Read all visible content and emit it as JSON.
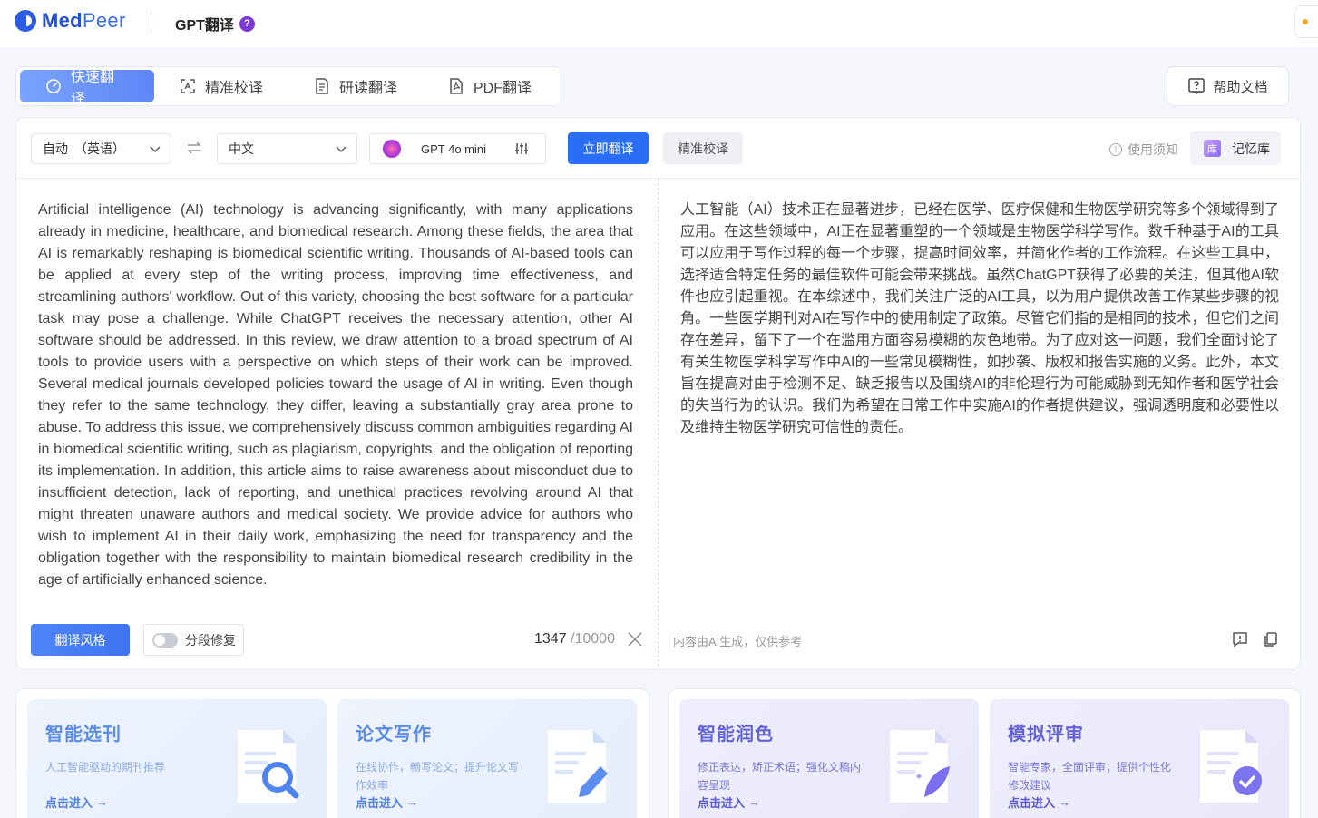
{
  "header": {
    "logo_text_bold": "Med",
    "logo_text_light": "Peer",
    "title": "GPT翻译",
    "help_mark": "?"
  },
  "modes": {
    "tabs": [
      {
        "label": "快速翻译",
        "icon": "gauge-icon",
        "active": true
      },
      {
        "label": "精准校译",
        "icon": "scan-icon",
        "active": false
      },
      {
        "label": "研读翻译",
        "icon": "document-icon",
        "active": false
      },
      {
        "label": "PDF翻译",
        "icon": "pdf-icon",
        "active": false
      }
    ],
    "help_doc": "帮助文档"
  },
  "toolbar": {
    "source_lang": "自动　（英语）",
    "target_lang": "中文",
    "model": "GPT 4o mini",
    "translate_btn": "立即翻译",
    "proof_btn": "精准校译",
    "notice": "使用须知",
    "memory_icon_text": "库",
    "memory": "记忆库"
  },
  "source_text": "Artificial intelligence (AI) technology is advancing significantly, with many applications already in medicine, healthcare, and biomedical research. Among these fields, the area that AI is remarkably reshaping is biomedical scientific writing. Thousands of AI-based tools can be applied at every step of the writing process, improving time effectiveness, and streamlining authors' workflow. Out of this variety, choosing the best software for a particular task may pose a challenge. While ChatGPT receives the necessary attention, other AI software should be addressed. In this review, we draw attention to a broad spectrum of AI tools to provide users with a perspective on which steps of their work can be improved. Several medical journals developed policies toward the usage of AI in writing. Even though they refer to the same technology, they differ, leaving a substantially gray area prone to abuse. To address this issue, we comprehensively discuss common ambiguities regarding AI in biomedical scientific writing, such as plagiarism, copyrights, and the obligation of reporting its implementation. In addition, this article aims to raise awareness about misconduct due to insufficient detection, lack of reporting, and unethical practices revolving around AI that might threaten unaware authors and medical society. We provide advice for authors who wish to implement AI in their daily work, emphasizing the need for transparency and the obligation together with the responsibility to maintain biomedical research credibility in the age of artificially enhanced science.",
  "target_text": "人工智能（AI）技术正在显著进步，已经在医学、医疗保健和生物医学研究等多个领域得到了应用。在这些领域中，AI正在显著重塑的一个领域是生物医学科学写作。数千种基于AI的工具可以应用于写作过程的每一个步骤，提高时间效率，并简化作者的工作流程。在这些工具中，选择适合特定任务的最佳软件可能会带来挑战。虽然ChatGPT获得了必要的关注，但其他AI软件也应引起重视。在本综述中，我们关注广泛的AI工具，以为用户提供改善工作某些步骤的视角。一些医学期刊对AI在写作中的使用制定了政策。尽管它们指的是相同的技术，但它们之间存在差异，留下了一个在滥用方面容易模糊的灰色地带。为了应对这一问题，我们全面讨论了有关生物医学科学写作中AI的一些常见模糊性，如抄袭、版权和报告实施的义务。此外，本文旨在提高对由于检测不足、缺乏报告以及围绕AI的非伦理行为可能威胁到无知作者和医学社会的失当行为的认识。我们为希望在日常工作中实施AI的作者提供建议，强调透明度和必要性以及维持生物医学研究可信性的责任。",
  "footer": {
    "style_btn": "翻译风格",
    "segment_label": "分段修复",
    "count_current": "1347",
    "count_max": " /10000",
    "ai_note": "内容由AI生成，仅供参考"
  },
  "cards": [
    {
      "title": "智能选刊",
      "desc": "人工智能驱动的期刊推荐",
      "go": "点击进入",
      "icon": "magnifier-doc-icon"
    },
    {
      "title": "论文写作",
      "desc": "在线协作，畅写论文；提升论文写作效率",
      "go": "点击进入",
      "icon": "pen-doc-icon"
    },
    {
      "title": "智能润色",
      "desc": "修正表达，矫正术语；强化文稿内容呈现",
      "go": "点击进入",
      "icon": "feather-doc-icon"
    },
    {
      "title": "模拟评审",
      "desc": "智能专家，全面评审；提供个性化修改建议",
      "go": "点击进入",
      "icon": "check-doc-icon"
    }
  ]
}
